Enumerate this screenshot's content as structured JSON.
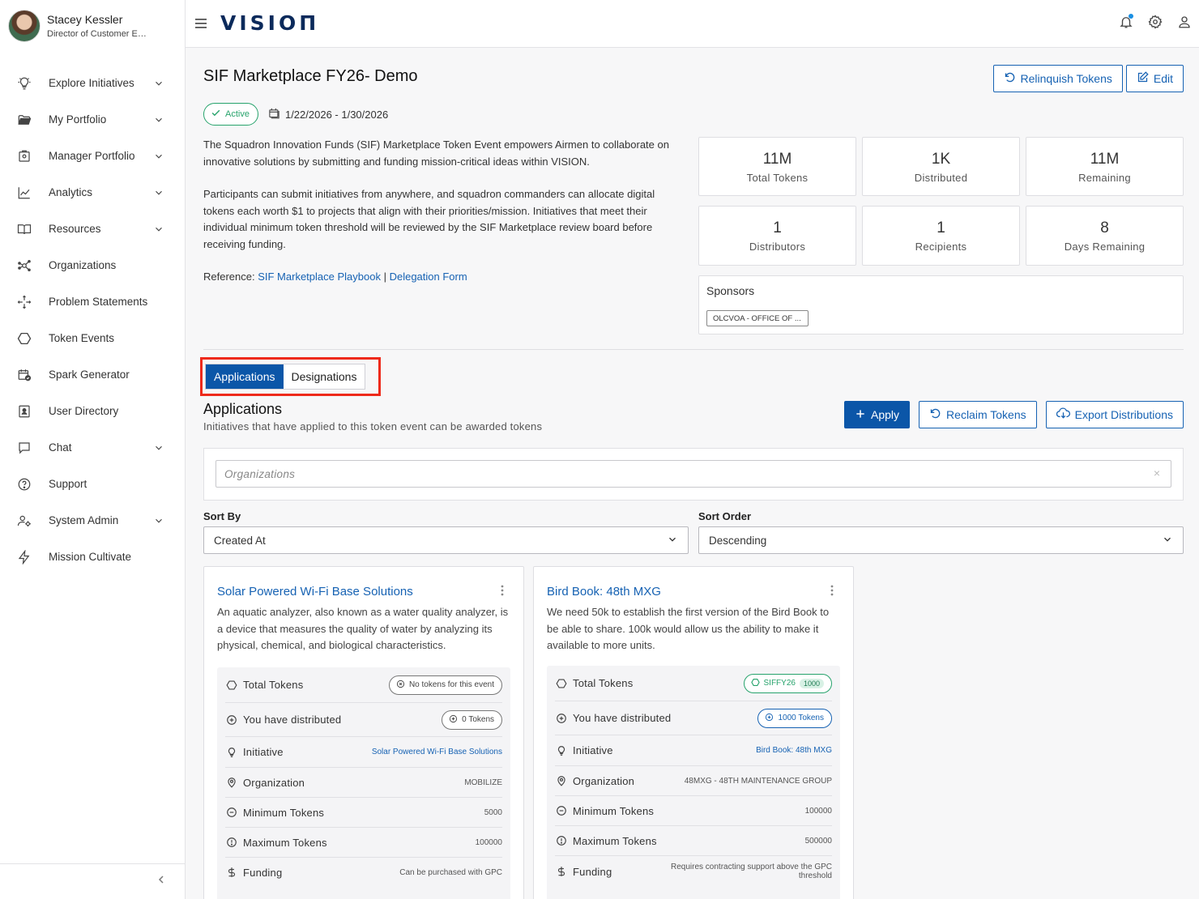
{
  "user": {
    "name": "Stacey Kessler",
    "role": "Director of Customer Experience"
  },
  "nav": [
    {
      "label": "Explore Initiatives",
      "icon": "lightbulb-icon",
      "glyph": "☼",
      "chev": true
    },
    {
      "label": "My Portfolio",
      "icon": "folder-open-icon",
      "glyph": "▰",
      "chev": true
    },
    {
      "label": "Manager Portfolio",
      "icon": "briefcase-icon",
      "glyph": "▣",
      "chev": true
    },
    {
      "label": "Analytics",
      "icon": "line-chart-icon",
      "glyph": "⟋",
      "chev": true
    },
    {
      "label": "Resources",
      "icon": "book-open-icon",
      "glyph": "◫",
      "chev": true
    },
    {
      "label": "Organizations",
      "icon": "network-icon",
      "glyph": "⋈",
      "chev": false
    },
    {
      "label": "Problem Statements",
      "icon": "move-arrows-icon",
      "glyph": "✣",
      "chev": false
    },
    {
      "label": "Token Events",
      "icon": "hexagon-icon",
      "glyph": "⬡",
      "chev": false
    },
    {
      "label": "Spark Generator",
      "icon": "calendar-check-icon",
      "glyph": "▤",
      "chev": false
    },
    {
      "label": "User Directory",
      "icon": "id-card-icon",
      "glyph": "▦",
      "chev": false
    },
    {
      "label": "Chat",
      "icon": "chat-bubble-icon",
      "glyph": "◻",
      "chev": true
    },
    {
      "label": "Support",
      "icon": "help-circle-icon",
      "glyph": "?",
      "chev": false
    },
    {
      "label": "System Admin",
      "icon": "users-gear-icon",
      "glyph": "⚙",
      "chev": true
    },
    {
      "label": "Mission Cultivate",
      "icon": "bolt-icon",
      "glyph": "ϟ",
      "chev": false
    }
  ],
  "logo": "VISIOП",
  "page": {
    "title": "SIF Marketplace FY26- Demo",
    "relinquish_label": "Relinquish Tokens",
    "edit_label": "Edit",
    "status": "Active",
    "date_range": "1/22/2026 - 1/30/2026",
    "desc_1": "The Squadron Innovation Funds (SIF) Marketplace Token Event empowers Airmen to collaborate on innovative solutions by submitting and funding mission-critical ideas within VISION.",
    "desc_2": "Participants can submit initiatives from anywhere, and squadron commanders can allocate digital tokens each worth $1 to projects that align with their priorities/mission. Initiatives that meet their individual minimum token threshold will be reviewed by the SIF Marketplace review board before receiving funding.",
    "reference_label": "Reference:",
    "reference_link_1": "SIF Marketplace Playbook",
    "reference_sep": "|",
    "reference_link_2": "Delegation Form"
  },
  "stats": [
    {
      "value": "11M",
      "label": "Total Tokens"
    },
    {
      "value": "1K",
      "label": "Distributed"
    },
    {
      "value": "11M",
      "label": "Remaining"
    },
    {
      "value": "1",
      "label": "Distributors"
    },
    {
      "value": "1",
      "label": "Recipients"
    },
    {
      "value": "8",
      "label": "Days Remaining"
    }
  ],
  "sponsors": {
    "title": "Sponsors",
    "chip": "OLCVOA - OFFICE OF ..."
  },
  "tabs": [
    {
      "label": "Applications",
      "active": true
    },
    {
      "label": "Designations",
      "active": false
    }
  ],
  "applications": {
    "title": "Applications",
    "subtitle": "Initiatives that have applied to this token event can be awarded tokens",
    "apply_label": "Apply",
    "reclaim_label": "Reclaim Tokens",
    "export_label": "Export Distributions",
    "filter_placeholder": "Organizations",
    "clear_glyph": "×"
  },
  "sort": {
    "sort_by_label": "Sort By",
    "sort_by_value": "Created At",
    "sort_order_label": "Sort Order",
    "sort_order_value": "Descending"
  },
  "cards": [
    {
      "title": "Solar Powered Wi-Fi Base Solutions",
      "desc": "An aquatic analyzer, also known as a water quality analyzer, is a device that measures the quality of water by analyzing its physical, chemical, and biological characteristics.",
      "rows": {
        "total_tokens": {
          "label": "Total Tokens",
          "chip": "No tokens for this event"
        },
        "distributed": {
          "label": "You have distributed",
          "chip": "0 Tokens"
        },
        "initiative": {
          "label": "Initiative",
          "value": "Solar Powered Wi-Fi Base Solutions"
        },
        "organization": {
          "label": "Organization",
          "value": "MOBILIZE"
        },
        "min_tokens": {
          "label": "Minimum Tokens",
          "value": "5000"
        },
        "max_tokens": {
          "label": "Maximum Tokens",
          "value": "100000"
        },
        "funding": {
          "label": "Funding",
          "value": "Can be purchased with GPC"
        }
      }
    },
    {
      "title": "Bird Book: 48th MXG",
      "desc": "We need 50k to establish the first version of the Bird Book to be able to share. 100k would allow us the ability to make it available to more units.",
      "rows": {
        "total_tokens": {
          "label": "Total Tokens",
          "chip": "SIFFY26",
          "count": "1000"
        },
        "distributed": {
          "label": "You have distributed",
          "chip": "1000 Tokens"
        },
        "initiative": {
          "label": "Initiative",
          "value": "Bird Book: 48th MXG"
        },
        "organization": {
          "label": "Organization",
          "value": "48MXG - 48TH MAINTENANCE GROUP"
        },
        "min_tokens": {
          "label": "Minimum Tokens",
          "value": "100000"
        },
        "max_tokens": {
          "label": "Maximum Tokens",
          "value": "500000"
        },
        "funding": {
          "label": "Funding",
          "value": "Requires contracting support above the GPC threshold"
        }
      }
    }
  ],
  "colors": {
    "primary": "#0b56a8",
    "link": "#1662b3",
    "success": "#27a36c",
    "highlight": "#ee2a1b",
    "logo": "#0b2a5b"
  }
}
